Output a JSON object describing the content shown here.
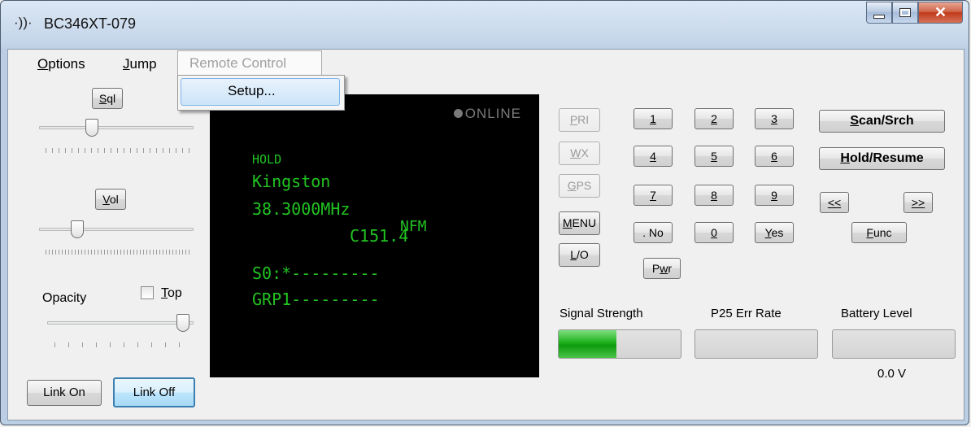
{
  "window": {
    "title": "BC346XT-079",
    "title_icon": "signal-waves-icon"
  },
  "menubar": {
    "options": "Options",
    "jump": "Jump",
    "remote_control": "Remote Control",
    "dropdown": {
      "setup": "Setup..."
    }
  },
  "left_panel": {
    "sql_button": "Sql",
    "vol_button": "Vol",
    "opacity_label": "Opacity",
    "top_label": "Top",
    "top_checked": false,
    "sql_level": 0.27,
    "vol_level": 0.17,
    "opacity_level": 1.0,
    "link_on": "Link On",
    "link_off": "Link Off"
  },
  "display": {
    "online": "ONLINE",
    "line_hold": "HOLD",
    "line_name": "Kingston",
    "line_freq": "38.3000MHz",
    "line_mode": "NFM",
    "line_tone": "C151.4",
    "line_s0": "S0:*---------",
    "line_grp": "GRP1---------"
  },
  "keypad": {
    "pri": "PRI",
    "wx": "WX",
    "gps": "GPS",
    "menu": "MENU",
    "lo": "L/O",
    "k1": "1",
    "k2": "2",
    "k3": "3",
    "k4": "4",
    "k5": "5",
    "k6": "6",
    "k7": "7",
    "k8": "8",
    "k9": "9",
    "dot_no": ". No",
    "k0": "0",
    "yes": "Yes",
    "pwr": "Pwr",
    "scan_srch": "Scan/Srch",
    "hold_resume": "Hold/Resume",
    "prev": "<<",
    "next": ">>",
    "func": "Func"
  },
  "meters": {
    "signal_label": "Signal Strength",
    "p25_label": "P25 Err Rate",
    "battery_label": "Battery Level",
    "signal_level": 0.47,
    "p25_level": 0,
    "battery_level": 0,
    "battery_value": "0.0 V",
    "fill_color": "#1cb01c"
  }
}
